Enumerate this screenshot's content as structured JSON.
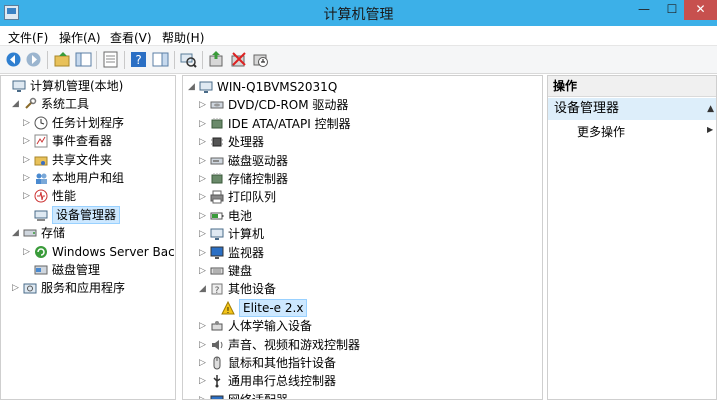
{
  "window": {
    "title": "计算机管理",
    "minimize": "—",
    "maximize": "☐",
    "close": "✕"
  },
  "menu": [
    "文件(F)",
    "操作(A)",
    "查看(V)",
    "帮助(H)"
  ],
  "left_tree": [
    {
      "label": "计算机管理(本地)",
      "level": 0,
      "caret": "",
      "icon": "computer-management-icon",
      "selected": false
    },
    {
      "label": "系统工具",
      "level": 1,
      "caret": "◢",
      "icon": "tools-icon",
      "selected": false
    },
    {
      "label": "任务计划程序",
      "level": 2,
      "caret": "▷",
      "icon": "clock-icon",
      "selected": false
    },
    {
      "label": "事件查看器",
      "level": 2,
      "caret": "▷",
      "icon": "event-viewer-icon",
      "selected": false
    },
    {
      "label": "共享文件夹",
      "level": 2,
      "caret": "▷",
      "icon": "shared-folder-icon",
      "selected": false
    },
    {
      "label": "本地用户和组",
      "level": 2,
      "caret": "▷",
      "icon": "users-icon",
      "selected": false
    },
    {
      "label": "性能",
      "level": 2,
      "caret": "▷",
      "icon": "performance-icon",
      "selected": false
    },
    {
      "label": "设备管理器",
      "level": 2,
      "caret": "",
      "icon": "device-manager-icon",
      "selected": true
    },
    {
      "label": "存储",
      "level": 1,
      "caret": "◢",
      "icon": "storage-icon",
      "selected": false
    },
    {
      "label": "Windows Server Backup",
      "level": 2,
      "caret": "▷",
      "icon": "backup-icon",
      "selected": false
    },
    {
      "label": "磁盘管理",
      "level": 2,
      "caret": "",
      "icon": "disk-management-icon",
      "selected": false
    },
    {
      "label": "服务和应用程序",
      "level": 1,
      "caret": "▷",
      "icon": "services-icon",
      "selected": false
    }
  ],
  "device_tree": [
    {
      "label": "WIN-Q1BVMS2031Q",
      "level": 0,
      "caret": "◢",
      "icon": "computer-icon",
      "selected": false
    },
    {
      "label": "DVD/CD-ROM 驱动器",
      "level": 1,
      "caret": "▷",
      "icon": "dvd-drive-icon",
      "selected": false
    },
    {
      "label": "IDE ATA/ATAPI 控制器",
      "level": 1,
      "caret": "▷",
      "icon": "ide-controller-icon",
      "selected": false
    },
    {
      "label": "处理器",
      "level": 1,
      "caret": "▷",
      "icon": "processor-icon",
      "selected": false
    },
    {
      "label": "磁盘驱动器",
      "level": 1,
      "caret": "▷",
      "icon": "disk-drive-icon",
      "selected": false
    },
    {
      "label": "存储控制器",
      "level": 1,
      "caret": "▷",
      "icon": "storage-controller-icon",
      "selected": false
    },
    {
      "label": "打印队列",
      "level": 1,
      "caret": "▷",
      "icon": "printer-icon",
      "selected": false
    },
    {
      "label": "电池",
      "level": 1,
      "caret": "▷",
      "icon": "battery-icon",
      "selected": false
    },
    {
      "label": "计算机",
      "level": 1,
      "caret": "▷",
      "icon": "computer-icon",
      "selected": false
    },
    {
      "label": "监视器",
      "level": 1,
      "caret": "▷",
      "icon": "monitor-icon",
      "selected": false
    },
    {
      "label": "键盘",
      "level": 1,
      "caret": "▷",
      "icon": "keyboard-icon",
      "selected": false
    },
    {
      "label": "其他设备",
      "level": 1,
      "caret": "◢",
      "icon": "other-devices-icon",
      "selected": false
    },
    {
      "label": "Elite-e 2.x",
      "level": 2,
      "caret": "",
      "icon": "warning-device-icon",
      "selected": true
    },
    {
      "label": "人体学输入设备",
      "level": 1,
      "caret": "▷",
      "icon": "hid-icon",
      "selected": false
    },
    {
      "label": "声音、视频和游戏控制器",
      "level": 1,
      "caret": "▷",
      "icon": "sound-icon",
      "selected": false
    },
    {
      "label": "鼠标和其他指针设备",
      "level": 1,
      "caret": "▷",
      "icon": "mouse-icon",
      "selected": false
    },
    {
      "label": "通用串行总线控制器",
      "level": 1,
      "caret": "▷",
      "icon": "usb-icon",
      "selected": false
    },
    {
      "label": "网络适配器",
      "level": 1,
      "caret": "▷",
      "icon": "network-adapter-icon",
      "selected": false
    }
  ],
  "actions": {
    "header": "操作",
    "group": "设备管理器",
    "group_arrow": "▲",
    "item": "更多操作",
    "item_arrow": "▶"
  },
  "colors": {
    "titlebar": "#3cb0e8",
    "close_button": "#c7504e",
    "selection_bg": "#cde8ff",
    "actions_group_bg": "#ddeefa"
  }
}
